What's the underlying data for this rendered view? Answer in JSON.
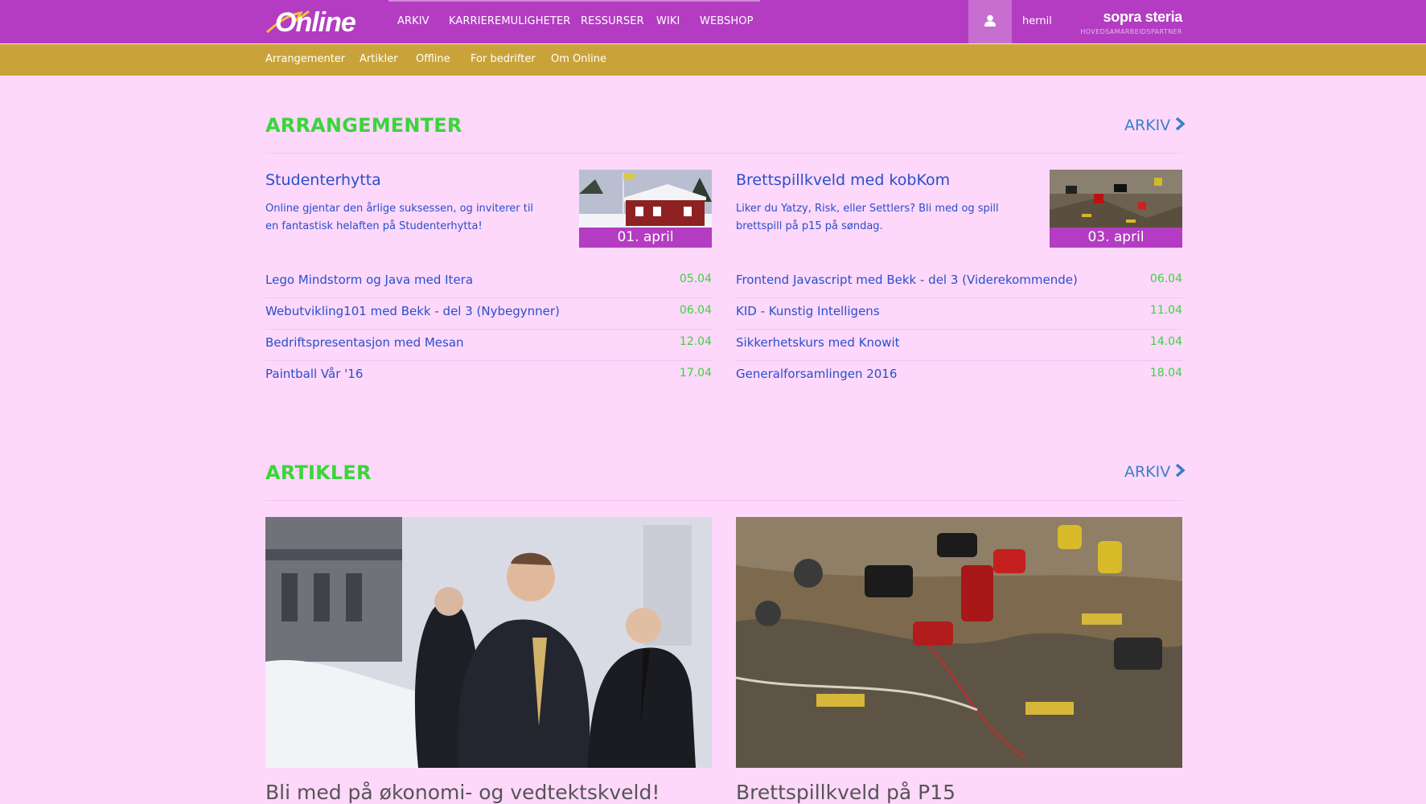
{
  "header": {
    "logo_text": "Online",
    "nav": [
      "ARKIV",
      "KARRIEREMULIGHETER",
      "RESSURSER",
      "WIKI",
      "WEBSHOP"
    ],
    "user_icon": "user-icon",
    "username": "hernil",
    "sponsor_name": "sopra steria",
    "sponsor_sub": "HOVEDSAMARBEIDSPARTNER"
  },
  "subnav": [
    "Arrangementer",
    "Artikler",
    "Offline",
    "For bedrifter",
    "Om Online"
  ],
  "events": {
    "title": "ARRANGEMENTER",
    "archive": "ARKIV",
    "featured": [
      {
        "title": "Studenterhytta",
        "desc": "Online gjentar den årlige suksessen, og inviterer til en fantastisk helaften på Studenterhytta!",
        "date": "01. april"
      },
      {
        "title": "Brettspillkveld med kobKom",
        "desc": "Liker du Yatzy, Risk, eller Settlers? Bli med og spill brettspill på p15 på søndag.",
        "date": "03. april"
      }
    ],
    "list_left": [
      {
        "title": "Lego Mindstorm og Java med Itera",
        "date": "05.04"
      },
      {
        "title": "Webutvikling101 med Bekk - del 3 (Nybegynner)",
        "date": "06.04"
      },
      {
        "title": "Bedriftspresentasjon med Mesan",
        "date": "12.04"
      },
      {
        "title": "Paintball Vår '16",
        "date": "17.04"
      }
    ],
    "list_right": [
      {
        "title": "Frontend Javascript med Bekk - del 3 (Viderekommende)",
        "date": "06.04"
      },
      {
        "title": "KID - Kunstig Intelligens",
        "date": "11.04"
      },
      {
        "title": "Sikkerhetskurs med Knowit",
        "date": "14.04"
      },
      {
        "title": "Generalforsamlingen 2016",
        "date": "18.04"
      }
    ]
  },
  "articles": {
    "title": "ARTIKLER",
    "archive": "ARKIV",
    "items": [
      {
        "title": "Bli med på økonomi- og vedtektskveld!"
      },
      {
        "title": "Brettspillkveld på P15"
      }
    ]
  },
  "colors": {
    "primary": "#b33cc2",
    "secondary": "#c9a33a",
    "background": "#fdd8fb",
    "accent_green": "#3ad53a",
    "link_blue": "#2a4fc9"
  }
}
